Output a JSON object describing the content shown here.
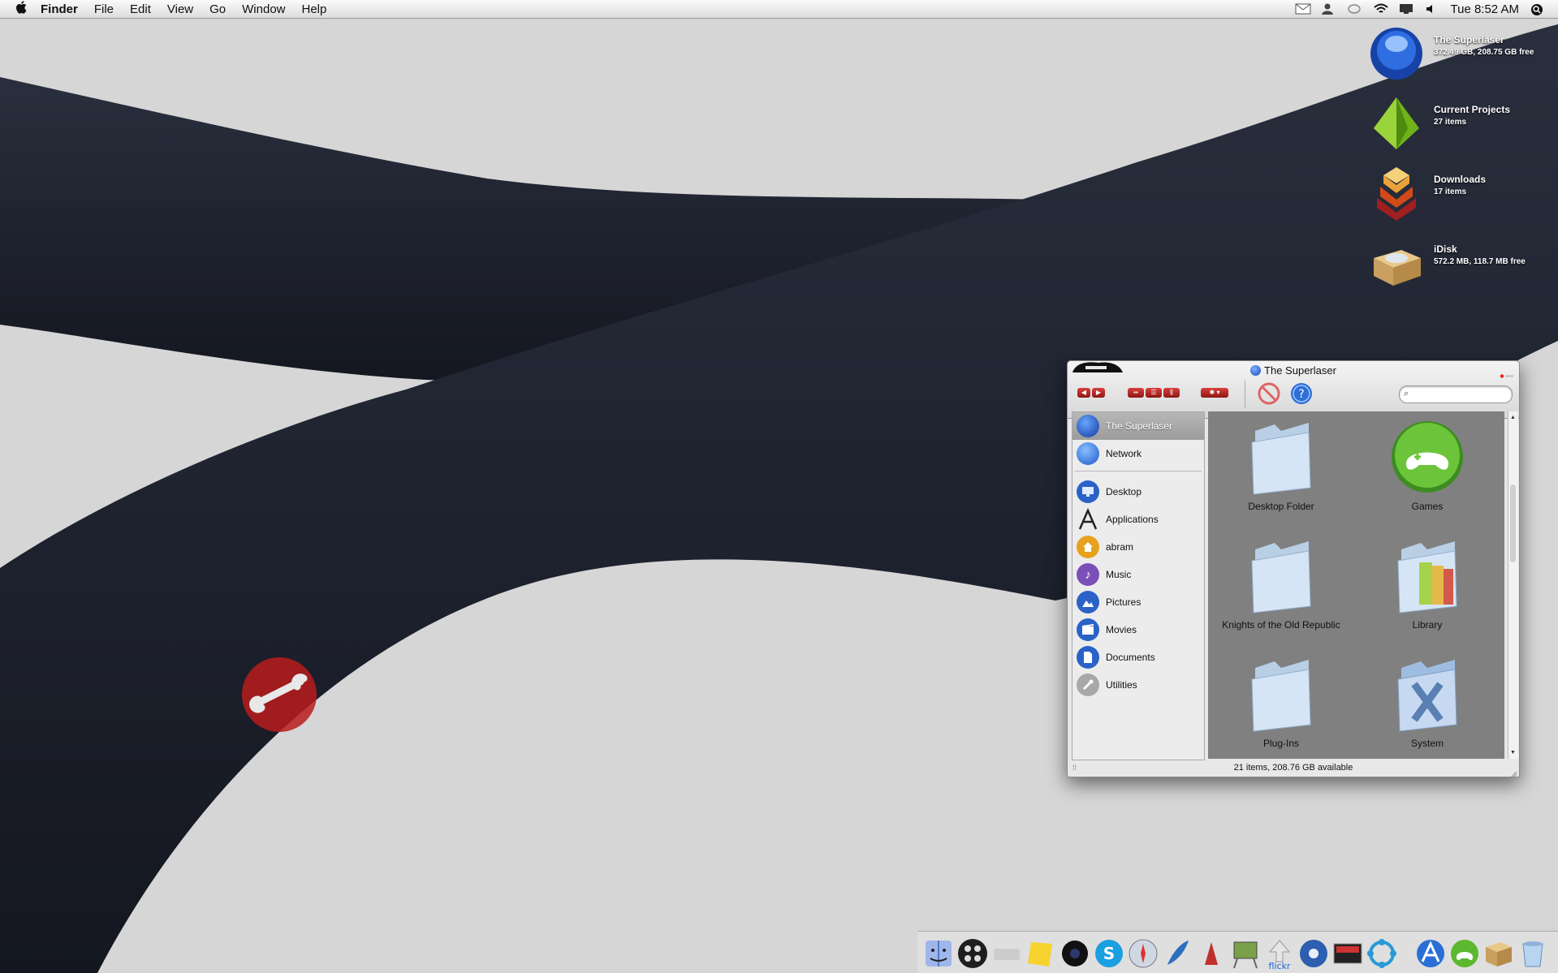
{
  "menubar": {
    "apple": "",
    "app_name": "Finder",
    "menus": [
      "File",
      "Edit",
      "View",
      "Go",
      "Window",
      "Help"
    ],
    "status_icons": [
      "mail-icon",
      "user-icon",
      "chat-icon",
      "wifi-icon",
      "display-icon",
      "volume-icon"
    ],
    "clock": "Tue 8:52 AM",
    "spotlight_icon": "spotlight-icon"
  },
  "desktop_icons": [
    {
      "name": "The Superlaser",
      "info": "372.49 GB, 208.75 GB free",
      "icon": "drive-icon"
    },
    {
      "name": "Current Projects",
      "info": "27 items",
      "icon": "projects-icon"
    },
    {
      "name": "Downloads",
      "info": "17 items",
      "icon": "downloads-icon"
    },
    {
      "name": "iDisk",
      "info": "572.2 MB, 118.7 MB free",
      "icon": "idisk-icon"
    }
  ],
  "window": {
    "title": "The Superlaser",
    "status": "21 items, 208.76 GB available",
    "search_placeholder": "",
    "sidebar": {
      "devices": [
        {
          "label": "The Superlaser",
          "icon": "drive-icon",
          "selected": true
        },
        {
          "label": "Network",
          "icon": "network-icon"
        }
      ],
      "places": [
        {
          "label": "Desktop",
          "icon": "desktop-icon"
        },
        {
          "label": "Applications",
          "icon": "applications-icon"
        },
        {
          "label": "abram",
          "icon": "home-icon"
        },
        {
          "label": "Music",
          "icon": "music-icon"
        },
        {
          "label": "Pictures",
          "icon": "pictures-icon"
        },
        {
          "label": "Movies",
          "icon": "movies-icon"
        },
        {
          "label": "Documents",
          "icon": "documents-icon"
        },
        {
          "label": "Utilities",
          "icon": "utilities-icon"
        }
      ]
    },
    "items": [
      {
        "label": "Desktop Folder",
        "icon": "folder-icon"
      },
      {
        "label": "Games",
        "icon": "games-icon"
      },
      {
        "label": "Knights of the Old Republic",
        "icon": "folder-icon"
      },
      {
        "label": "Library",
        "icon": "library-folder-icon"
      },
      {
        "label": "Plug-Ins",
        "icon": "folder-icon"
      },
      {
        "label": "System",
        "icon": "system-folder-icon"
      }
    ]
  },
  "dock": {
    "icons": [
      "finder-icon",
      "dashboard-icon",
      "apple-tv-icon",
      "stickies-icon",
      "camera-icon",
      "skype-icon",
      "safari-icon",
      "feather-icon",
      "ink-icon",
      "preview-icon",
      "flickr-icon",
      "itunes-icon",
      "terminal-icon",
      "network-icon",
      "app-store-icon",
      "games-icon",
      "package-icon",
      "trash-icon"
    ]
  },
  "colors": {
    "accent": "#c0302c",
    "content_bg": "#808080",
    "wallpaper_bg": "#d6d6d6",
    "tube": "#1e2230"
  }
}
